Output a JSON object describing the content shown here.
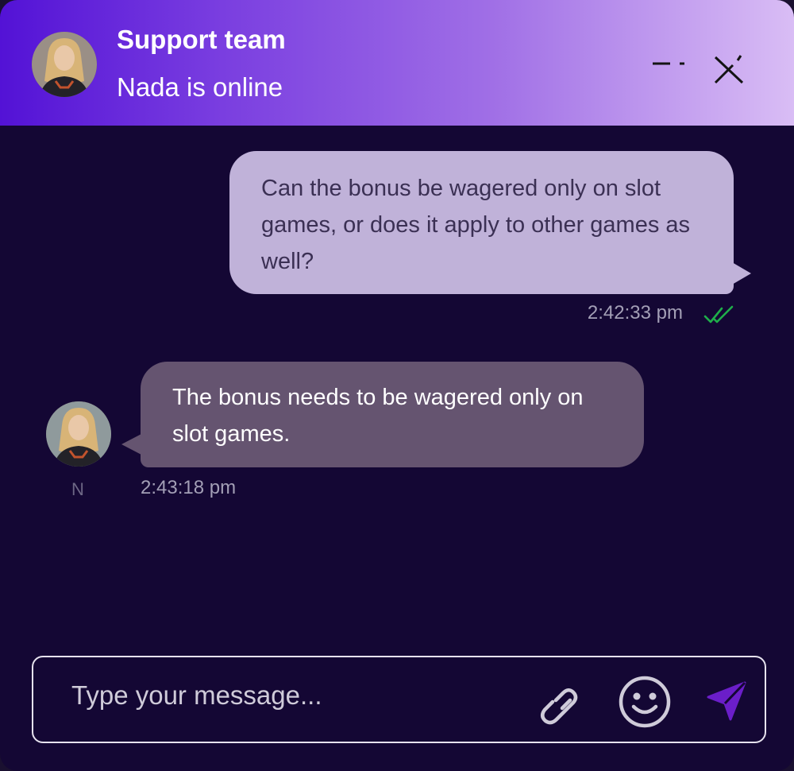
{
  "header": {
    "title": "Support team",
    "status": "Nada is online",
    "minimize_icon": "minimize-icon",
    "close_icon": "close-icon"
  },
  "messages": [
    {
      "direction": "outgoing",
      "text": "Can the bonus be wagered only on slot games, or does it apply to other games as well?",
      "time": "2:42:33 pm",
      "receipt_icon": "double-check-icon",
      "receipt_color": "#1fae4a"
    },
    {
      "direction": "incoming",
      "text": "The bonus needs to be wagered only on slot games.",
      "time": "2:43:18 pm",
      "sender_initial": "N"
    }
  ],
  "composer": {
    "placeholder": "Type your message...",
    "value": "",
    "attach_icon": "paperclip-icon",
    "emoji_icon": "smiley-icon",
    "send_icon": "send-icon",
    "send_color": "#6b1ec9"
  },
  "colors": {
    "header_gradient_start": "#5312d6",
    "header_gradient_end": "#d9bdf5",
    "background": "#140734",
    "outgoing_bubble": "#c0b2d9",
    "incoming_bubble": "#655470"
  }
}
